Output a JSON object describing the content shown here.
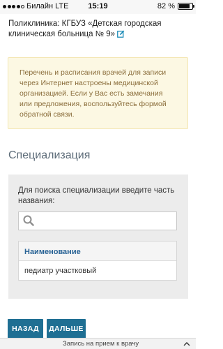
{
  "status_bar": {
    "carrier": "Билайн",
    "network": "LTE",
    "time": "15:19",
    "battery": "82 %",
    "battery_level": 0.82
  },
  "clinic": {
    "text": "Поликлиника: КГБУЗ «Детская городская клиническая больница № 9»"
  },
  "notice": {
    "text": "Перечень и расписания врачей для записи через Интернет настроены медицинской организацией. Если у Вас есть замечания или предложения, воспользуйтесь формой обратной связи."
  },
  "section_title": "Специализация",
  "search_panel": {
    "label": "Для поиска специализации введите часть названия:",
    "input_value": "",
    "table_header": "Наименование",
    "rows": [
      "педиатр участковый"
    ]
  },
  "buttons": {
    "back": "НАЗАД",
    "next": "ДАЛЬШЕ"
  },
  "bottom_bar": {
    "url_text": "Запись на прием к врачу"
  },
  "colors": {
    "primary_button": "#1f6f93",
    "notice_bg": "#fcf8e3",
    "notice_text": "#8a6d3b",
    "table_header_text": "#2a6496"
  }
}
